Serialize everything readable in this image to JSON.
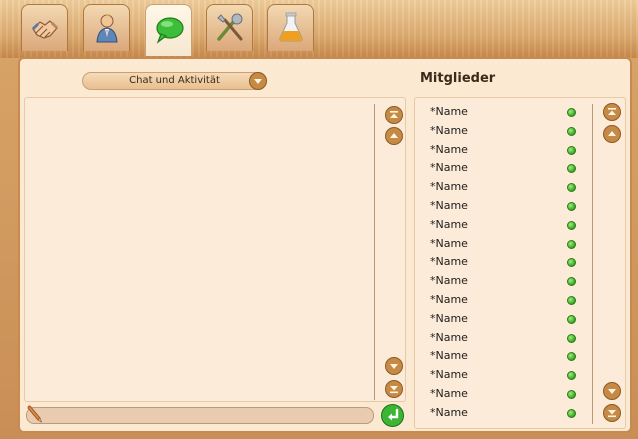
{
  "tabs": [
    {
      "name": "handshake-icon",
      "active": false
    },
    {
      "name": "user-icon",
      "active": false
    },
    {
      "name": "chat-bubble-icon",
      "active": true
    },
    {
      "name": "tools-icon",
      "active": false
    },
    {
      "name": "flask-icon",
      "active": false
    }
  ],
  "chat": {
    "dropdown_label": "Chat und Aktivität"
  },
  "members": {
    "title": "Mitglieder",
    "list": [
      {
        "name": "*Name",
        "status": "online"
      },
      {
        "name": "*Name",
        "status": "online"
      },
      {
        "name": "*Name",
        "status": "online"
      },
      {
        "name": "*Name",
        "status": "online"
      },
      {
        "name": "*Name",
        "status": "online"
      },
      {
        "name": "*Name",
        "status": "online"
      },
      {
        "name": "*Name",
        "status": "online"
      },
      {
        "name": "*Name",
        "status": "online"
      },
      {
        "name": "*Name",
        "status": "online"
      },
      {
        "name": "*Name",
        "status": "online"
      },
      {
        "name": "*Name",
        "status": "online"
      },
      {
        "name": "*Name",
        "status": "online"
      },
      {
        "name": "*Name",
        "status": "online"
      },
      {
        "name": "*Name",
        "status": "online"
      },
      {
        "name": "*Name",
        "status": "online"
      },
      {
        "name": "*Name",
        "status": "online"
      },
      {
        "name": "*Name",
        "status": "online"
      }
    ]
  },
  "colors": {
    "online": "#39a523",
    "accent": "#c88a52"
  }
}
